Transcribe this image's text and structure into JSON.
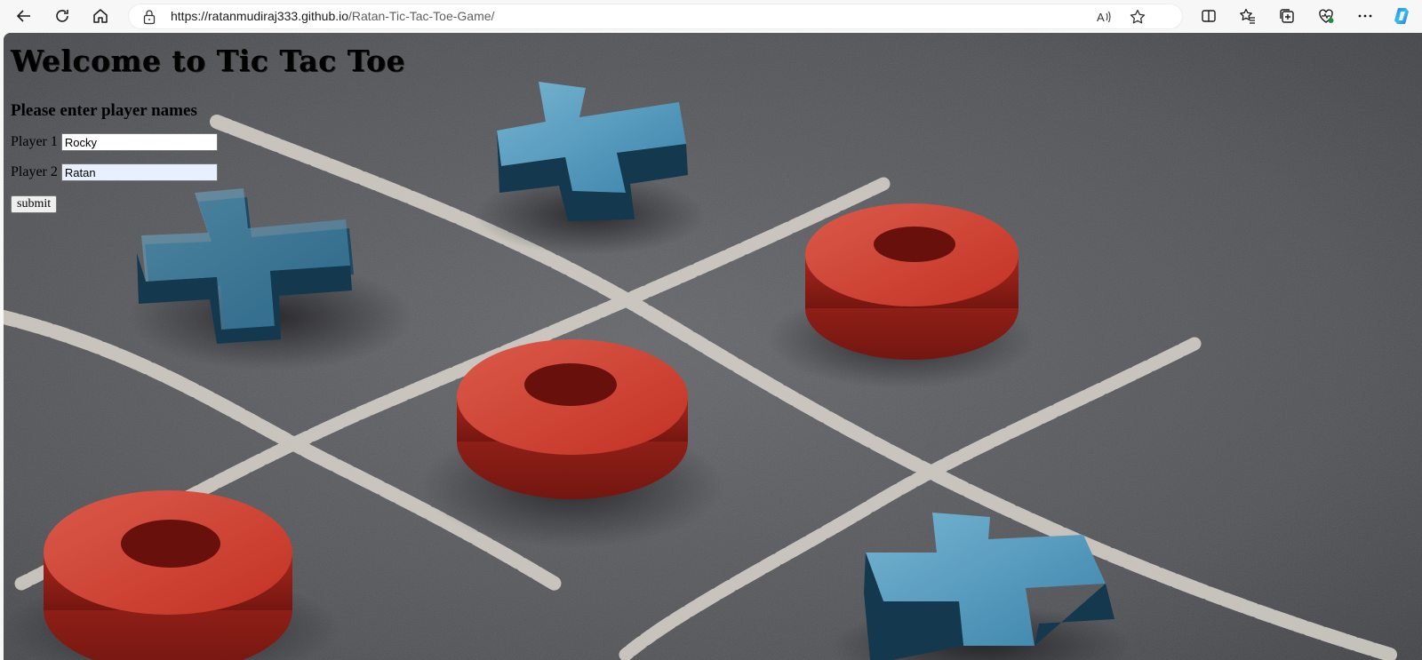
{
  "browser": {
    "url_host": "https://ratanmudiraj333.github.io",
    "url_path": "/Ratan-Tic-Tac-Toe-Game/",
    "nav_icons": [
      "back-icon",
      "refresh-icon",
      "home-icon"
    ],
    "address_icons": [
      "lock-icon",
      "read-aloud-icon",
      "favorite-star-icon"
    ],
    "toolbar_icons": [
      "split-screen-icon",
      "favorites-icon",
      "collections-icon",
      "browser-essentials-icon",
      "more-icon",
      "copilot-icon"
    ]
  },
  "page": {
    "title": "Welcome to Tic Tac Toe",
    "subtitle": "Please enter player names",
    "player1_label": "Player 1",
    "player1_value": "Rocky",
    "player2_label": "Player 2",
    "player2_value": "Ratan",
    "submit_label": "submit"
  },
  "background": {
    "description_icon": "tic-tac-toe-board-photo",
    "x_color": "#4e9cc4",
    "o_color": "#d63a2c",
    "board_color": "#5c5d62",
    "chalk_color": "#e9e4da"
  }
}
